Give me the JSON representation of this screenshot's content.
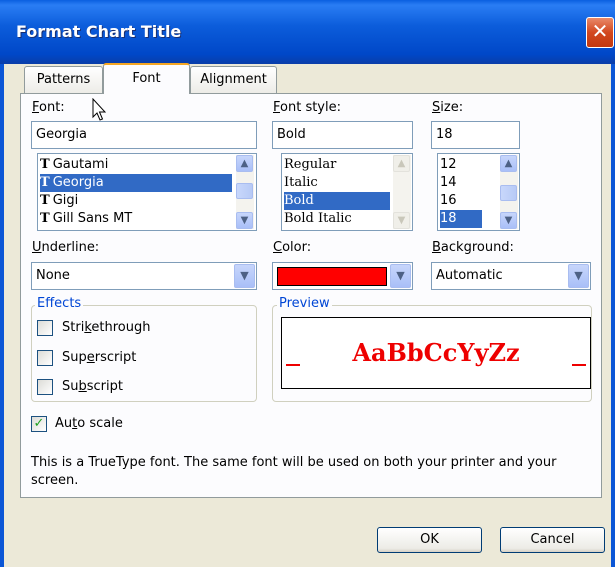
{
  "window": {
    "title": "Format Chart Title",
    "close_glyph": "✕"
  },
  "tabs": [
    {
      "label": "Patterns"
    },
    {
      "label": "Font"
    },
    {
      "label": "Alignment"
    }
  ],
  "font": {
    "label": "Font:",
    "value": "Georgia",
    "items": [
      "Gautami",
      "Georgia",
      "Gigi",
      "Gill Sans MT"
    ],
    "selected": "Georgia",
    "item_icon": "truetype-icon"
  },
  "font_style": {
    "label": "Font style:",
    "value": "Bold",
    "items": [
      "Regular",
      "Italic",
      "Bold",
      "Bold Italic"
    ],
    "selected": "Bold"
  },
  "size": {
    "label": "Size:",
    "value": "18",
    "items": [
      "12",
      "14",
      "16",
      "18"
    ],
    "selected": "18"
  },
  "underline": {
    "label": "Underline:",
    "value": "None"
  },
  "color": {
    "label": "Color:",
    "swatch": "#ff0000"
  },
  "background": {
    "label": "Background:",
    "value": "Automatic"
  },
  "effects": {
    "label": "Effects",
    "strikethrough": {
      "label": "Strikethrough",
      "checked": false
    },
    "superscript": {
      "label": "Superscript",
      "checked": false
    },
    "subscript": {
      "label": "Subscript",
      "checked": false
    }
  },
  "preview": {
    "label": "Preview",
    "sample": "AaBbCcYyZz",
    "color": "#ee0000"
  },
  "auto_scale": {
    "label": "Auto scale",
    "checked": true,
    "check_glyph": "✓"
  },
  "info": "This is a TrueType font.  The same font will be used on both your printer and your screen.",
  "buttons": {
    "ok": "OK",
    "cancel": "Cancel"
  },
  "glyphs": {
    "up": "▲",
    "down": "▼"
  }
}
